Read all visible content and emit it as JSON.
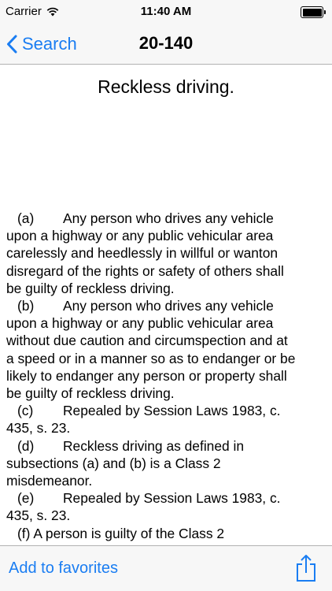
{
  "status_bar": {
    "carrier": "Carrier",
    "time": "11:40 AM"
  },
  "nav": {
    "back_label": "Search",
    "title": "20-140"
  },
  "document": {
    "title": "Reckless driving.",
    "paragraphs": [
      {
        "label": "(a)",
        "lines": [
          "Any person who drives any vehicle",
          "upon a highway or any public vehicular area",
          "carelessly and heedlessly in willful or wanton",
          "disregard of the rights or safety of others shall",
          "be guilty of reckless driving."
        ]
      },
      {
        "label": "(b)",
        "lines": [
          "Any person who drives any vehicle",
          "upon a highway or any public vehicular area",
          "without due caution and circumspection and at",
          "a speed or in a manner so as to endanger or be",
          "likely to endanger any person or property shall",
          "be guilty of reckless driving."
        ]
      },
      {
        "label": "(c)",
        "lines": [
          "Repealed by Session Laws 1983, c.",
          "435, s. 23."
        ]
      },
      {
        "label": "(d)",
        "lines": [
          "Reckless driving as defined in",
          "subsections (a) and (b) is a Class 2",
          "misdemeanor."
        ]
      },
      {
        "label": "(e)",
        "lines": [
          "Repealed by Session Laws 1983, c.",
          "435, s. 23."
        ]
      },
      {
        "label": "(f)",
        "lines": [
          "A person is guilty of the Class 2"
        ]
      }
    ]
  },
  "toolbar": {
    "favorites_label": "Add to favorites",
    "share_icon": "share-icon"
  },
  "colors": {
    "accent": "#1a7df2",
    "bar_background": "#f7f7f7"
  }
}
